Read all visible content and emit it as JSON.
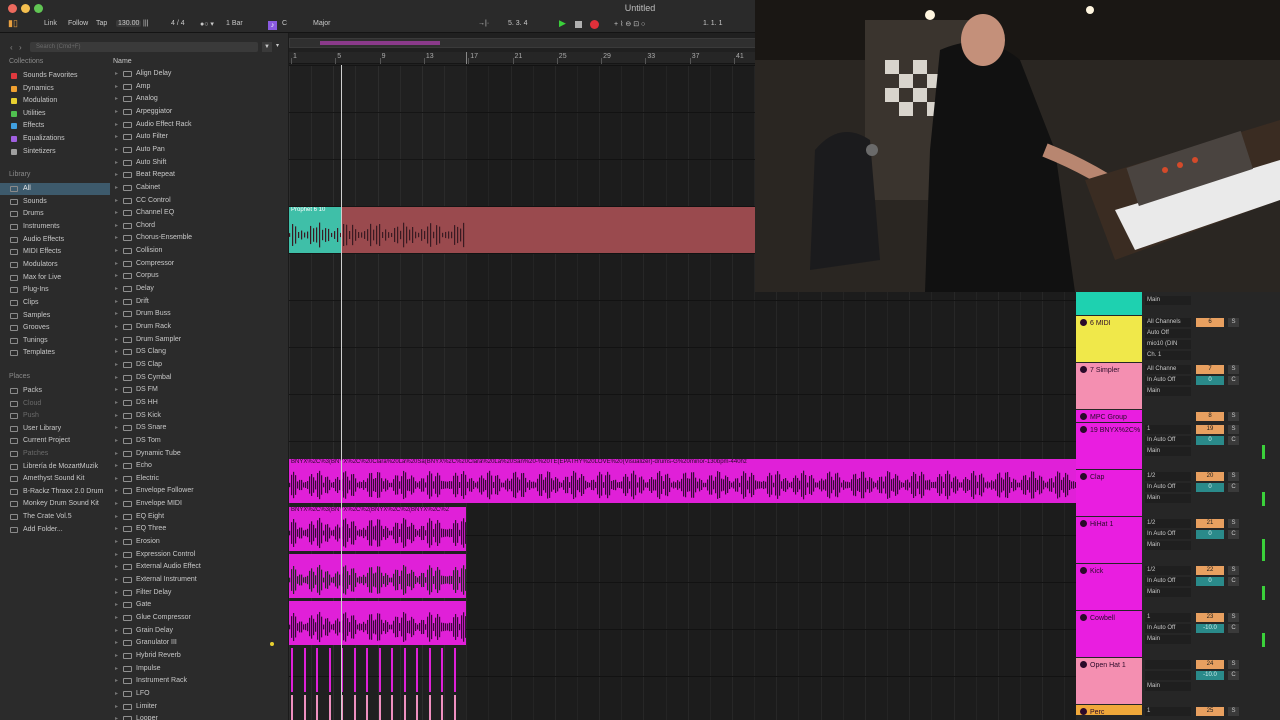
{
  "window": {
    "title": "Untitled"
  },
  "transport": {
    "link": "Link",
    "follow": "Follow",
    "tap": "Tap",
    "tempo": "130.00",
    "signature": "4 / 4",
    "quantize": "1 Bar",
    "key": "C",
    "scale": "Major",
    "position": "5.  3.  4",
    "loop_start": "1.  1.  1"
  },
  "browser": {
    "search_placeholder": "Search (Cmd+F)",
    "collections_header": "Collections",
    "collections": [
      {
        "label": "Sounds Favorites",
        "color": "#e0393e"
      },
      {
        "label": "Dynamics",
        "color": "#f0a030"
      },
      {
        "label": "Modulation",
        "color": "#e8d030"
      },
      {
        "label": "Utilities",
        "color": "#50c050"
      },
      {
        "label": "Effects",
        "color": "#40a0e0"
      },
      {
        "label": "Equalizations",
        "color": "#a060e0"
      },
      {
        "label": "Sintetizers",
        "color": "#a0a0a0"
      }
    ],
    "library_header": "Library",
    "library": [
      "All",
      "Sounds",
      "Drums",
      "Instruments",
      "Audio Effects",
      "MIDI Effects",
      "Modulators",
      "Max for Live",
      "Plug-Ins",
      "Clips",
      "Samples",
      "Grooves",
      "Tunings",
      "Templates"
    ],
    "places_header": "Places",
    "places": [
      "Packs",
      "Cloud",
      "Push",
      "User Library",
      "Current Project",
      "Patches",
      "Librería de MozartMuzik",
      "Amethyst Sound Kit",
      "B-Rackz Thraxx 2.0 Drum",
      "Monkey Drum Sound Kit",
      "The Crate Vol.5",
      "Add Folder..."
    ],
    "name_header": "Name",
    "items": [
      "Align Delay",
      "Amp",
      "Analog",
      "Arpeggiator",
      "Audio Effect Rack",
      "Auto Filter",
      "Auto Pan",
      "Auto Shift",
      "Beat Repeat",
      "Cabinet",
      "CC Control",
      "Channel EQ",
      "Chord",
      "Chorus-Ensemble",
      "Collision",
      "Compressor",
      "Corpus",
      "Delay",
      "Drift",
      "Drum Buss",
      "Drum Rack",
      "Drum Sampler",
      "DS Clang",
      "DS Clap",
      "DS Cymbal",
      "DS FM",
      "DS HH",
      "DS Kick",
      "DS Snare",
      "DS Tom",
      "Dynamic Tube",
      "Echo",
      "Electric",
      "Envelope Follower",
      "Envelope MIDI",
      "EQ Eight",
      "EQ Three",
      "Erosion",
      "Expression Control",
      "External Audio Effect",
      "External Instrument",
      "Filter Delay",
      "Gate",
      "Glue Compressor",
      "Grain Delay",
      "Granulator III",
      "Hybrid Reverb",
      "Impulse",
      "Instrument Rack",
      "LFO",
      "Limiter",
      "Looper"
    ]
  },
  "ruler": {
    "bars": [
      "1",
      "5",
      "9",
      "13",
      "17",
      "21",
      "25",
      "29",
      "33",
      "37",
      "41"
    ]
  },
  "clips": {
    "prophet": "Prophet 6 10",
    "bnyx_long": "BNYX%2C%3(BNYX%2C%20Clara%20La%20Sa(BNYX%2C%20Clara%20La%20San%20-%20TE(EPATHY%20LOVE%20(Visualizer)-drums-G%20minor-130bpm-440hz",
    "bnyx_short": "BNYX%2C%3(BNYX%2C%2(BNYX%2C%2(BNYX%2C%2"
  },
  "tracks": [
    {
      "name": "6 MIDI",
      "io": [
        "All Channels",
        "Auto  Off",
        "mio10 (DIN",
        "Ch. 1"
      ],
      "num": "6",
      "color": "#f0e84a"
    },
    {
      "name": "7 Simpler",
      "io": [
        "All Channe",
        "In  Auto  Off",
        "Main"
      ],
      "num": "7",
      "vol": "0",
      "pan": "C",
      "color": "#f48fb1"
    },
    {
      "name": "MPC Group",
      "num": "8",
      "color": "#e91ee0"
    },
    {
      "name": "19 BNYX%2C%",
      "io": [
        "1",
        "In  Auto  Off",
        "Main"
      ],
      "num": "19",
      "vol": "0",
      "pan": "C",
      "color": "#e91ee0"
    },
    {
      "name": "Clap",
      "io": [
        "1/2",
        "In  Auto  Off",
        "Main"
      ],
      "num": "20",
      "vol": "0",
      "pan": "C",
      "color": "#e91ee0"
    },
    {
      "name": "HiHat 1",
      "io": [
        "1/2",
        "In  Auto  Off",
        "Main"
      ],
      "num": "21",
      "vol": "0",
      "pan": "C",
      "color": "#e91ee0"
    },
    {
      "name": "Kick",
      "io": [
        "1/2",
        "In  Auto  Off",
        "Main"
      ],
      "num": "22",
      "vol": "0",
      "pan": "C",
      "color": "#e91ee0"
    },
    {
      "name": "Cowbell",
      "io": [
        "1",
        "In  Auto  Off",
        "Main"
      ],
      "num": "23",
      "vol": "-10.0",
      "pan": "C",
      "color": "#e91ee0"
    },
    {
      "name": "Open Hat 1",
      "io": [
        "",
        "",
        "Main"
      ],
      "num": "24",
      "vol": "-10.0",
      "pan": "C",
      "color": "#f48fb1"
    },
    {
      "name": "Perc",
      "io": [
        "1"
      ],
      "num": "25",
      "color": "#f0a83a"
    }
  ],
  "top_track": {
    "io": "Main",
    "color": "#1ed1b0"
  },
  "mixer_labels": {
    "solo": "S",
    "pan": "C"
  }
}
